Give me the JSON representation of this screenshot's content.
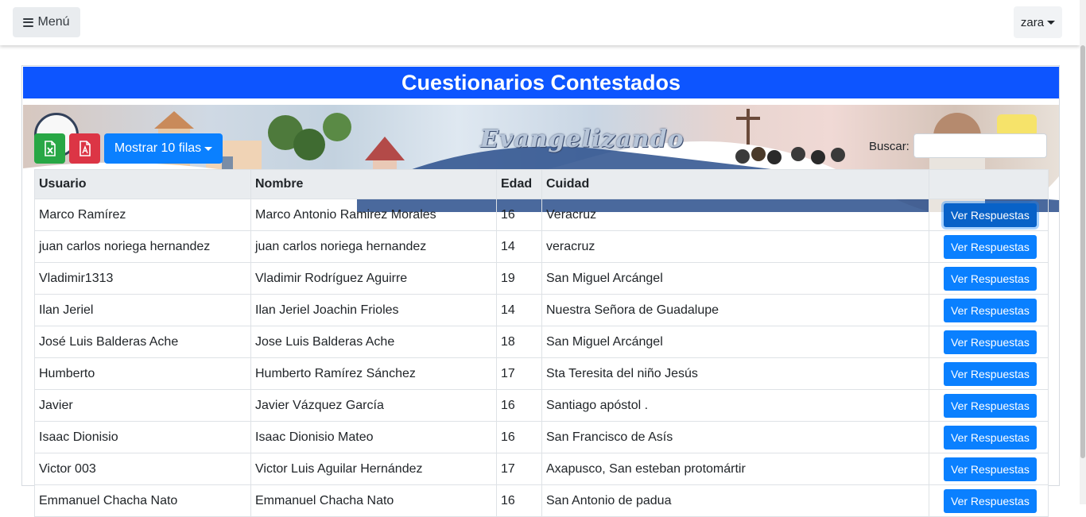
{
  "navbar": {
    "menu_label": "Menú",
    "user_label": "zara"
  },
  "card": {
    "title": "Cuestionarios Contestados",
    "banner_text": "Evangelizando"
  },
  "toolbar": {
    "excel_icon": "file-excel-icon",
    "pdf_icon": "file-pdf-icon",
    "rows_label": "Mostrar 10 filas",
    "search_label": "Buscar:",
    "search_value": ""
  },
  "table": {
    "headers": [
      "Usuario",
      "Nombre",
      "Edad",
      "Cuidad",
      ""
    ],
    "action_label": "Ver Respuestas",
    "rows": [
      {
        "usuario": "Marco Ramírez",
        "nombre": "Marco Antonio Ramirez Morales",
        "edad": "16",
        "ciudad": "Veracruz"
      },
      {
        "usuario": "juan carlos noriega hernandez",
        "nombre": "juan carlos noriega hernandez",
        "edad": "14",
        "ciudad": "veracruz"
      },
      {
        "usuario": "Vladimir1313",
        "nombre": "Vladimir Rodríguez Aguirre",
        "edad": "19",
        "ciudad": "San Miguel Arcángel"
      },
      {
        "usuario": "Ilan Jeriel",
        "nombre": "Ilan Jeriel Joachin Frioles",
        "edad": "14",
        "ciudad": "Nuestra Señora de Guadalupe"
      },
      {
        "usuario": "José Luis Balderas Ache",
        "nombre": "Jose Luis Balderas Ache",
        "edad": "18",
        "ciudad": "San Miguel Arcángel"
      },
      {
        "usuario": "Humberto",
        "nombre": "Humberto Ramírez Sánchez",
        "edad": "17",
        "ciudad": "Sta Teresita del niño Jesús"
      },
      {
        "usuario": "Javier",
        "nombre": "Javier Vázquez García",
        "edad": "16",
        "ciudad": "Santiago apóstol ."
      },
      {
        "usuario": "Isaac Dionisio",
        "nombre": "Isaac Dionisio Mateo",
        "edad": "16",
        "ciudad": "San Francisco de Asís"
      },
      {
        "usuario": "Victor 003",
        "nombre": "Victor Luis Aguilar Hernández",
        "edad": "17",
        "ciudad": "Axapusco, San esteban protomártir"
      },
      {
        "usuario": "Emmanuel Chacha Nato",
        "nombre": "Emmanuel Chacha Nato",
        "edad": "16",
        "ciudad": "San Antonio de padua"
      }
    ]
  }
}
